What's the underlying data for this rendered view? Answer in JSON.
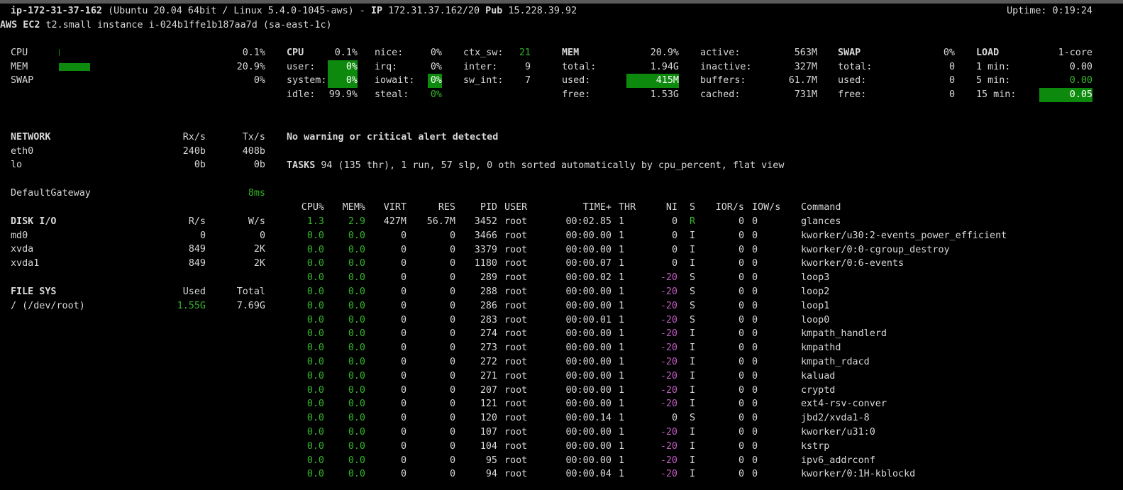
{
  "header": {
    "hostname": "ip-172-31-37-162",
    "os": "(Ubuntu 20.04 64bit / Linux 5.4.0-1045-aws)",
    "sep": "-",
    "ip_label": "IP",
    "ip": "172.31.37.162/20",
    "pub_label": "Pub",
    "pub": "15.228.39.92",
    "uptime": "Uptime: 0:19:24",
    "cloud_label": "AWS EC2",
    "cloud": "t2.small instance i-024b1ffe1b187aa7d (sa-east-1c)"
  },
  "quicklook": {
    "cpu_label": "CPU",
    "cpu": "0.1%",
    "cpu_fraction": 0.001,
    "mem_label": "MEM",
    "mem": "20.9%",
    "mem_fraction": 0.209,
    "swap_label": "SWAP",
    "swap": "0%",
    "swap_fraction": 0
  },
  "cpu": {
    "title": "CPU",
    "total": "0.1%",
    "user_label": "user:",
    "user": "0%",
    "system_label": "system:",
    "system": "0%",
    "idle_label": "idle:",
    "idle": "99.9%",
    "nice_label": "nice:",
    "nice": "0%",
    "irq_label": "irq:",
    "irq": "0%",
    "iowait_label": "iowait:",
    "iowait": "0%",
    "steal_label": "steal:",
    "steal": "0%",
    "ctx_sw_label": "ctx_sw:",
    "ctx_sw": "21",
    "inter_label": "inter:",
    "inter": "9",
    "sw_int_label": "sw_int:",
    "sw_int": "7"
  },
  "mem": {
    "title": "MEM",
    "percent": "20.9%",
    "total_label": "total:",
    "total": "1.94G",
    "used_label": "used:",
    "used": "415M",
    "free_label": "free:",
    "free": "1.53G",
    "active_label": "active:",
    "active": "563M",
    "inactive_label": "inactive:",
    "inactive": "327M",
    "buffers_label": "buffers:",
    "buffers": "61.7M",
    "cached_label": "cached:",
    "cached": "731M"
  },
  "swap": {
    "title": "SWAP",
    "percent": "0%",
    "total_label": "total:",
    "total": "0",
    "used_label": "used:",
    "used": "0",
    "free_label": "free:",
    "free": "0"
  },
  "load": {
    "title": "LOAD",
    "cores": "1-core",
    "min1_label": "1 min:",
    "min1": "0.00",
    "min5_label": "5 min:",
    "min5": "0.00",
    "min15_label": "15 min:",
    "min15": "0.05"
  },
  "network": {
    "title": "NETWORK",
    "rx_header": "Rx/s",
    "tx_header": "Tx/s",
    "interfaces": [
      {
        "name": "eth0",
        "rx": "240b",
        "tx": "408b"
      },
      {
        "name": "lo",
        "rx": "0b",
        "tx": "0b"
      }
    ]
  },
  "gateway": {
    "label": "DefaultGateway",
    "value": "8ms"
  },
  "diskio": {
    "title": "DISK I/O",
    "r_header": "R/s",
    "w_header": "W/s",
    "disks": [
      {
        "name": "md0",
        "r": "0",
        "w": "0"
      },
      {
        "name": "xvda",
        "r": "849",
        "w": "2K"
      },
      {
        "name": "xvda1",
        "r": "849",
        "w": "2K"
      }
    ]
  },
  "fs": {
    "title": "FILE SYS",
    "used_header": "Used",
    "total_header": "Total",
    "mounts": [
      {
        "name": "/ (/dev/root)",
        "used": "1.55G",
        "total": "7.69G"
      }
    ]
  },
  "alert": "No warning or critical alert detected",
  "tasks": {
    "label": "TASKS",
    "summary": "94 (135 thr), 1 run, 57 slp, 0 oth sorted automatically by cpu_percent, flat view"
  },
  "process_table": {
    "headers": {
      "cpu": "CPU%",
      "mem": "MEM%",
      "virt": "VIRT",
      "res": "RES",
      "pid": "PID",
      "user": "USER",
      "time": "TIME+",
      "thr": "THR",
      "ni": "NI",
      "s": "S",
      "ior": "IOR/s",
      "iow": "IOW/s",
      "cmd": "Command"
    },
    "rows": [
      {
        "cpu": "1.3",
        "mem": "2.9",
        "virt": "427M",
        "res": "56.7M",
        "pid": "3452",
        "user": "root",
        "time": "00:02.85",
        "thr": "1",
        "ni": "0",
        "s": "R",
        "ior": "0",
        "iow": "0",
        "cmd": "glances"
      },
      {
        "cpu": "0.0",
        "mem": "0.0",
        "virt": "0",
        "res": "0",
        "pid": "3466",
        "user": "root",
        "time": "00:00.00",
        "thr": "1",
        "ni": "0",
        "s": "I",
        "ior": "0",
        "iow": "0",
        "cmd": "kworker/u30:2-events_power_efficient"
      },
      {
        "cpu": "0.0",
        "mem": "0.0",
        "virt": "0",
        "res": "0",
        "pid": "3379",
        "user": "root",
        "time": "00:00.00",
        "thr": "1",
        "ni": "0",
        "s": "I",
        "ior": "0",
        "iow": "0",
        "cmd": "kworker/0:0-cgroup_destroy"
      },
      {
        "cpu": "0.0",
        "mem": "0.0",
        "virt": "0",
        "res": "0",
        "pid": "1180",
        "user": "root",
        "time": "00:00.07",
        "thr": "1",
        "ni": "0",
        "s": "I",
        "ior": "0",
        "iow": "0",
        "cmd": "kworker/0:6-events"
      },
      {
        "cpu": "0.0",
        "mem": "0.0",
        "virt": "0",
        "res": "0",
        "pid": "289",
        "user": "root",
        "time": "00:00.02",
        "thr": "1",
        "ni": "-20",
        "s": "S",
        "ior": "0",
        "iow": "0",
        "cmd": "loop3"
      },
      {
        "cpu": "0.0",
        "mem": "0.0",
        "virt": "0",
        "res": "0",
        "pid": "288",
        "user": "root",
        "time": "00:00.00",
        "thr": "1",
        "ni": "-20",
        "s": "S",
        "ior": "0",
        "iow": "0",
        "cmd": "loop2"
      },
      {
        "cpu": "0.0",
        "mem": "0.0",
        "virt": "0",
        "res": "0",
        "pid": "286",
        "user": "root",
        "time": "00:00.00",
        "thr": "1",
        "ni": "-20",
        "s": "S",
        "ior": "0",
        "iow": "0",
        "cmd": "loop1"
      },
      {
        "cpu": "0.0",
        "mem": "0.0",
        "virt": "0",
        "res": "0",
        "pid": "283",
        "user": "root",
        "time": "00:00.01",
        "thr": "1",
        "ni": "-20",
        "s": "S",
        "ior": "0",
        "iow": "0",
        "cmd": "loop0"
      },
      {
        "cpu": "0.0",
        "mem": "0.0",
        "virt": "0",
        "res": "0",
        "pid": "274",
        "user": "root",
        "time": "00:00.00",
        "thr": "1",
        "ni": "-20",
        "s": "I",
        "ior": "0",
        "iow": "0",
        "cmd": "kmpath_handlerd"
      },
      {
        "cpu": "0.0",
        "mem": "0.0",
        "virt": "0",
        "res": "0",
        "pid": "273",
        "user": "root",
        "time": "00:00.00",
        "thr": "1",
        "ni": "-20",
        "s": "I",
        "ior": "0",
        "iow": "0",
        "cmd": "kmpathd"
      },
      {
        "cpu": "0.0",
        "mem": "0.0",
        "virt": "0",
        "res": "0",
        "pid": "272",
        "user": "root",
        "time": "00:00.00",
        "thr": "1",
        "ni": "-20",
        "s": "I",
        "ior": "0",
        "iow": "0",
        "cmd": "kmpath_rdacd"
      },
      {
        "cpu": "0.0",
        "mem": "0.0",
        "virt": "0",
        "res": "0",
        "pid": "271",
        "user": "root",
        "time": "00:00.00",
        "thr": "1",
        "ni": "-20",
        "s": "I",
        "ior": "0",
        "iow": "0",
        "cmd": "kaluad"
      },
      {
        "cpu": "0.0",
        "mem": "0.0",
        "virt": "0",
        "res": "0",
        "pid": "207",
        "user": "root",
        "time": "00:00.00",
        "thr": "1",
        "ni": "-20",
        "s": "I",
        "ior": "0",
        "iow": "0",
        "cmd": "cryptd"
      },
      {
        "cpu": "0.0",
        "mem": "0.0",
        "virt": "0",
        "res": "0",
        "pid": "121",
        "user": "root",
        "time": "00:00.00",
        "thr": "1",
        "ni": "-20",
        "s": "I",
        "ior": "0",
        "iow": "0",
        "cmd": "ext4-rsv-conver"
      },
      {
        "cpu": "0.0",
        "mem": "0.0",
        "virt": "0",
        "res": "0",
        "pid": "120",
        "user": "root",
        "time": "00:00.14",
        "thr": "1",
        "ni": "0",
        "s": "S",
        "ior": "0",
        "iow": "0",
        "cmd": "jbd2/xvda1-8"
      },
      {
        "cpu": "0.0",
        "mem": "0.0",
        "virt": "0",
        "res": "0",
        "pid": "107",
        "user": "root",
        "time": "00:00.00",
        "thr": "1",
        "ni": "-20",
        "s": "I",
        "ior": "0",
        "iow": "0",
        "cmd": "kworker/u31:0"
      },
      {
        "cpu": "0.0",
        "mem": "0.0",
        "virt": "0",
        "res": "0",
        "pid": "104",
        "user": "root",
        "time": "00:00.00",
        "thr": "1",
        "ni": "-20",
        "s": "I",
        "ior": "0",
        "iow": "0",
        "cmd": "kstrp"
      },
      {
        "cpu": "0.0",
        "mem": "0.0",
        "virt": "0",
        "res": "0",
        "pid": "95",
        "user": "root",
        "time": "00:00.00",
        "thr": "1",
        "ni": "-20",
        "s": "I",
        "ior": "0",
        "iow": "0",
        "cmd": "ipv6_addrconf"
      },
      {
        "cpu": "0.0",
        "mem": "0.0",
        "virt": "0",
        "res": "0",
        "pid": "94",
        "user": "root",
        "time": "00:00.04",
        "thr": "1",
        "ni": "-20",
        "s": "I",
        "ior": "0",
        "iow": "0",
        "cmd": "kworker/0:1H-kblockd"
      }
    ]
  }
}
